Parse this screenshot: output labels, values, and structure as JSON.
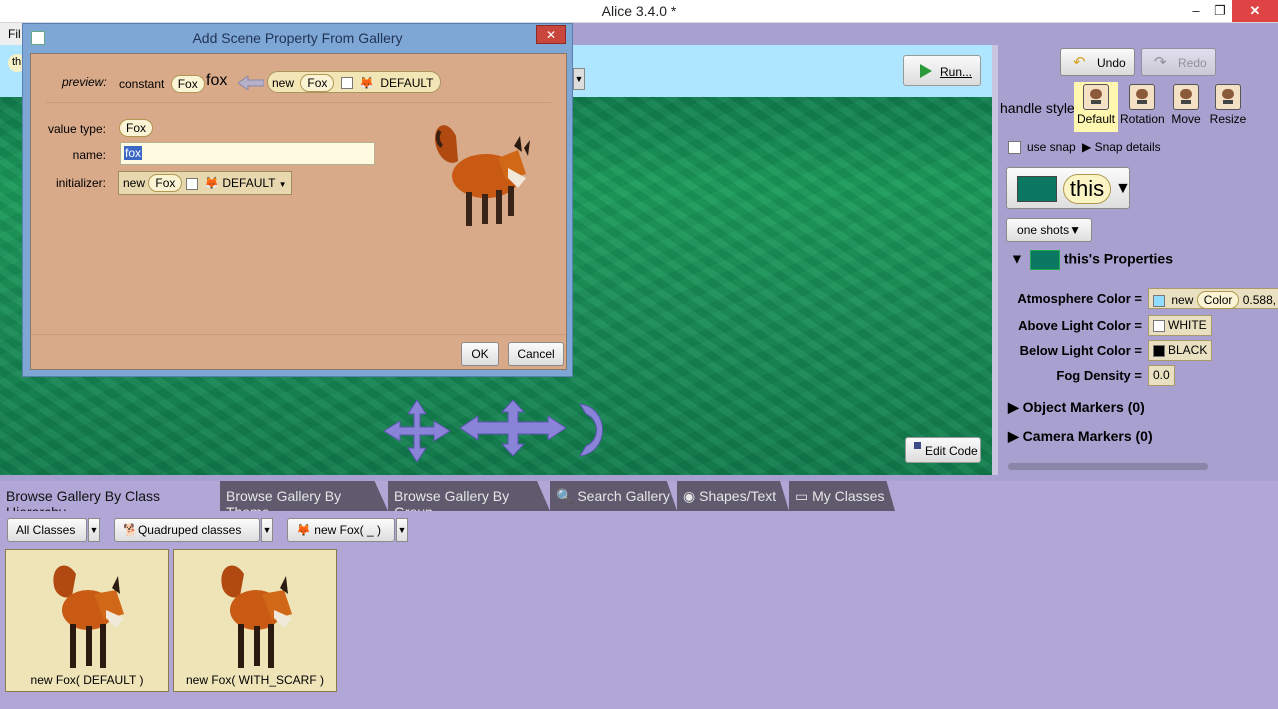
{
  "window": {
    "title": "Alice 3.4.0  *"
  },
  "menu": {
    "file_fragment": "Fil"
  },
  "scene": {
    "run_label": "Run...",
    "edit_code_label": "Edit Code",
    "scene_chip": "th"
  },
  "dialog": {
    "title": "Add Scene Property From Gallery",
    "preview_label": "preview:",
    "constant_label": "constant",
    "type_chip": "Fox",
    "name_value": "fox",
    "new_label": "new",
    "default_label": "DEFAULT",
    "value_type_label": "value type:",
    "name_label": "name:",
    "initializer_label": "initializer:",
    "ok_label": "OK",
    "cancel_label": "Cancel"
  },
  "right_panel": {
    "undo_label": "Undo",
    "redo_label": "Redo",
    "handle_style_label": "handle style:",
    "handles": [
      "Default",
      "Rotation",
      "Move",
      "Resize"
    ],
    "use_snap_label": "use snap",
    "snap_details_label": "Snap details",
    "this_label": "this",
    "one_shots_label": "one shots",
    "properties_header": "this's Properties",
    "atmosphere_label": "Atmosphere Color =",
    "atmosphere_new": "new",
    "atmosphere_type": "Color",
    "atmosphere_value": "0.588,",
    "above_light_label": "Above Light Color =",
    "above_light_value": "WHITE",
    "below_light_label": "Below Light Color =",
    "below_light_value": "BLACK",
    "fog_label": "Fog Density =",
    "fog_value": "0.0",
    "object_markers": "Object Markers (0)",
    "camera_markers": "Camera Markers (0)",
    "atmosphere_color_hex": "#8fdcff"
  },
  "gallery": {
    "tabs": [
      "Browse Gallery By Class Hierarchy",
      "Browse Gallery By Theme",
      "Browse Gallery By Group",
      "Search Gallery",
      "Shapes/Text",
      "My Classes"
    ],
    "all_classes": "All Classes",
    "quadruped": "Quadruped classes",
    "new_fox": "new Fox( _ )",
    "cards": [
      "new Fox( DEFAULT )",
      "new Fox( WITH_SCARF )"
    ]
  }
}
